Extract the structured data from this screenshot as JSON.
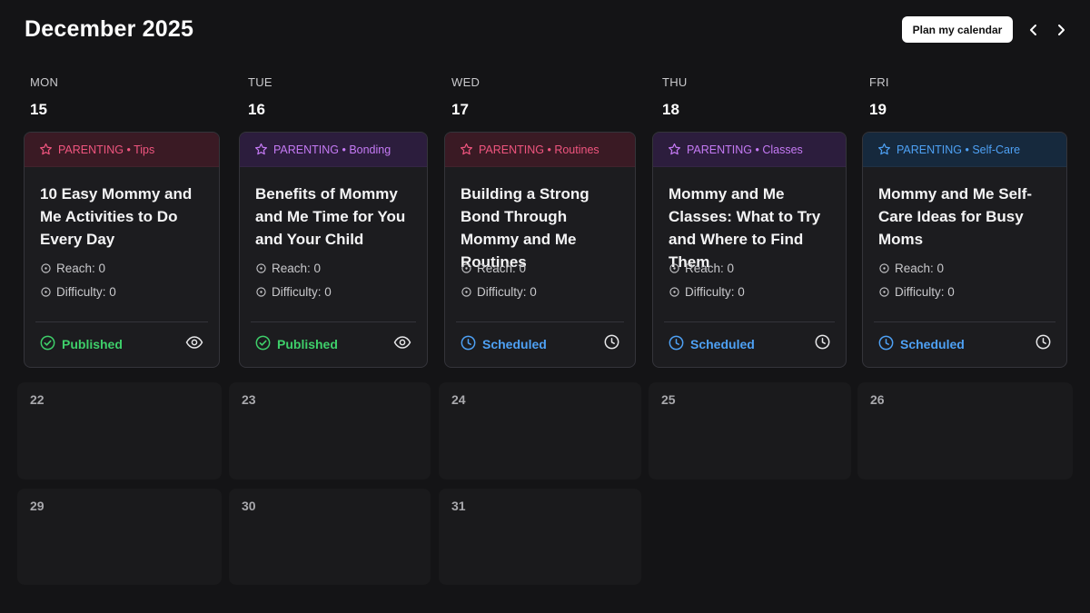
{
  "header": {
    "title": "December 2025",
    "plan_label": "Plan my calendar"
  },
  "week": [
    {
      "dow": "MON",
      "day": "15"
    },
    {
      "dow": "TUE",
      "day": "16"
    },
    {
      "dow": "WED",
      "day": "17"
    },
    {
      "dow": "THU",
      "day": "18"
    },
    {
      "dow": "FRI",
      "day": "19"
    }
  ],
  "posts": [
    {
      "category": "PARENTING • Tips",
      "accent": "#f0557f",
      "head_bg": "#3a1a24",
      "title": "10 Easy Mommy and Me Activities to Do Every Day",
      "reach_label": "Reach: 0",
      "difficulty_label": "Difficulty: 0",
      "status": "Published",
      "status_type": "published",
      "action_icon": "eye-icon"
    },
    {
      "category": "PARENTING • Bonding",
      "accent": "#c57af5",
      "head_bg": "#2c1d3d",
      "title": "Benefits of Mommy and Me Time for You and Your Child",
      "reach_label": "Reach: 0",
      "difficulty_label": "Difficulty: 0",
      "status": "Published",
      "status_type": "published",
      "action_icon": "eye-icon"
    },
    {
      "category": "PARENTING • Routines",
      "accent": "#f0557f",
      "head_bg": "#3a1a24",
      "title": "Building a Strong Bond Through Mommy and Me Routines",
      "reach_label": "Reach: 0",
      "difficulty_label": "Difficulty: 0",
      "status": "Scheduled",
      "status_type": "scheduled",
      "action_icon": "clock-icon"
    },
    {
      "category": "PARENTING • Classes",
      "accent": "#c57af5",
      "head_bg": "#2c1d3d",
      "title": "Mommy and Me Classes: What to Try and Where to Find Them",
      "reach_label": "Reach: 0",
      "difficulty_label": "Difficulty: 0",
      "status": "Scheduled",
      "status_type": "scheduled",
      "action_icon": "clock-icon"
    },
    {
      "category": "PARENTING • Self-Care",
      "accent": "#4ea1f5",
      "head_bg": "#16293d",
      "title": "Mommy and Me Self-Care Ideas for Busy Moms",
      "reach_label": "Reach: 0",
      "difficulty_label": "Difficulty: 0",
      "status": "Scheduled",
      "status_type": "scheduled",
      "action_icon": "clock-icon"
    }
  ],
  "weeks_after": [
    [
      "22",
      "23",
      "24",
      "25",
      "26"
    ],
    [
      "29",
      "30",
      "31"
    ]
  ],
  "colors": {
    "background": "#141416",
    "card": "#1c1c1f",
    "published": "#3ecf6a",
    "scheduled": "#4ea1f5"
  }
}
